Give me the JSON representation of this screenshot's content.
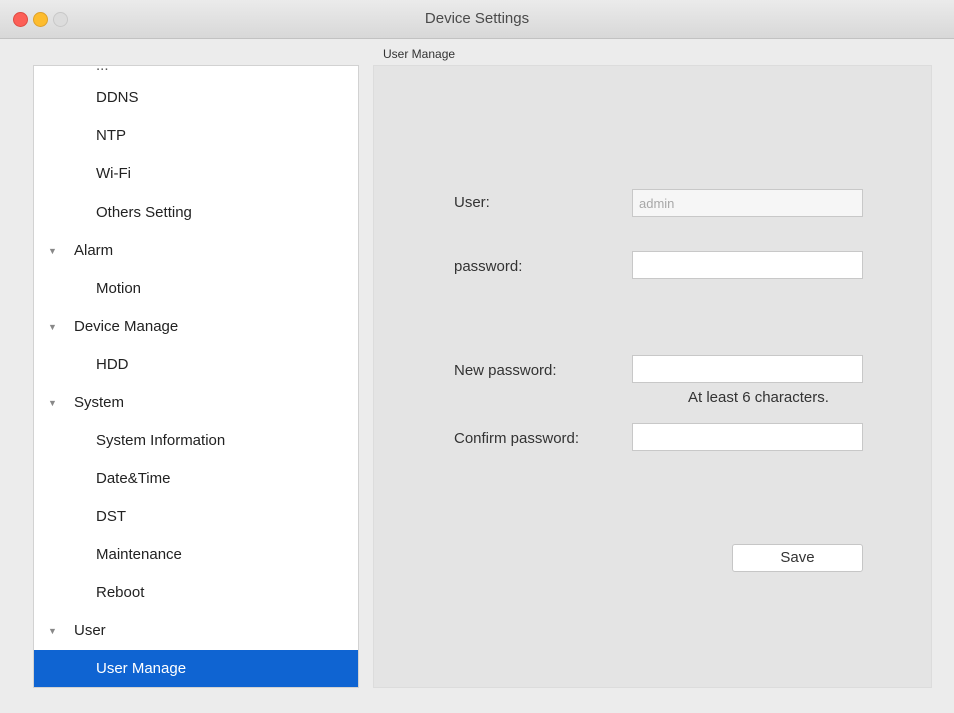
{
  "window": {
    "title": "Device Settings"
  },
  "sidebar": {
    "truncated_top": "...",
    "items": [
      {
        "label": "DDNS",
        "level": "child"
      },
      {
        "label": "NTP",
        "level": "child"
      },
      {
        "label": "Wi-Fi",
        "level": "child"
      },
      {
        "label": "Others Setting",
        "level": "child"
      },
      {
        "label": "Alarm",
        "level": "parent"
      },
      {
        "label": "Motion",
        "level": "child"
      },
      {
        "label": "Device Manage",
        "level": "parent"
      },
      {
        "label": "HDD",
        "level": "child"
      },
      {
        "label": "System",
        "level": "parent"
      },
      {
        "label": "System Information",
        "level": "child"
      },
      {
        "label": "Date&Time",
        "level": "child"
      },
      {
        "label": "DST",
        "level": "child"
      },
      {
        "label": "Maintenance",
        "level": "child"
      },
      {
        "label": "Reboot",
        "level": "child"
      },
      {
        "label": "User",
        "level": "parent"
      },
      {
        "label": "User Manage",
        "level": "child",
        "selected": true
      }
    ],
    "expand_glyph": "▼"
  },
  "panel": {
    "section_title": "User Manage",
    "user_label": "User:",
    "user_value": "admin",
    "password_label": "password:",
    "password_value": "",
    "new_password_label": "New password:",
    "new_password_value": "",
    "new_password_hint": "At least 6 characters.",
    "confirm_password_label": "Confirm password:",
    "confirm_password_value": "",
    "save_label": "Save"
  },
  "colors": {
    "selection": "#0f64d2",
    "close": "#fc5f57",
    "minimize": "#fdbc2e",
    "zoom": "#dcdcdc"
  }
}
